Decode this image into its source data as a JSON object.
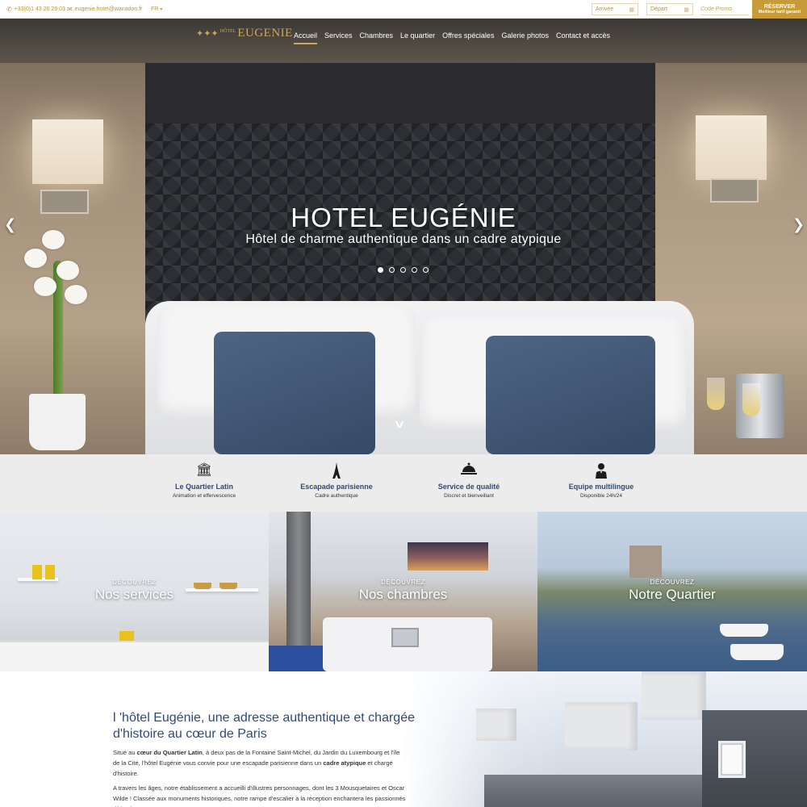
{
  "topbar": {
    "phone": "+33(0)1 43 26 29 03",
    "email": "eugenie.hotel@wanadoo.fr",
    "lang": "FR",
    "arrival_placeholder": "Arrivée",
    "departure_placeholder": "Départ",
    "promo_placeholder": "Code Promo",
    "reserve_label": "RÉSERVER",
    "reserve_sub": "Meilleur tarif garanti"
  },
  "nav": {
    "logo_small": "HÔTEL",
    "logo_name": "EUGENIE",
    "items": [
      {
        "label": "Accueil"
      },
      {
        "label": "Services"
      },
      {
        "label": "Chambres"
      },
      {
        "label": "Le quartier"
      },
      {
        "label": "Offres spéciales"
      },
      {
        "label": "Galerie photos"
      },
      {
        "label": "Contact et accès"
      }
    ],
    "active_index": 0
  },
  "hero": {
    "title": "HOTEL EUGÉNIE",
    "subtitle": "Hôtel de charme authentique dans un cadre atypique",
    "slide_count": 5,
    "active_slide": 1
  },
  "features": [
    {
      "icon": "monument-icon",
      "title": "Le Quartier Latin",
      "sub": "Animation et effervescence"
    },
    {
      "icon": "eiffel-tower-icon",
      "title": "Escapade parisienne",
      "sub": "Cadre authentique"
    },
    {
      "icon": "cloche-icon",
      "title": "Service de qualité",
      "sub": "Discret et bienveillant"
    },
    {
      "icon": "concierge-icon",
      "title": "Equipe multilingue",
      "sub": "Disponible 24h/24"
    }
  ],
  "tiles": [
    {
      "kicker": "DÉCOUVREZ",
      "title": "Nos services"
    },
    {
      "kicker": "DÉCOUVREZ",
      "title": "Nos chambres"
    },
    {
      "kicker": "DÉCOUVREZ",
      "title": "Notre Quartier"
    }
  ],
  "about": {
    "heading": "l 'hôtel Eugénie, une adresse authentique et chargée d'histoire au cœur de Paris",
    "p1_a": "Situé au ",
    "p1_b": "cœur du Quartier Latin",
    "p1_c": ", à deux pas de la Fontaine Saint-Michel, du Jardin du Luxembourg et l'île de la Cité, l'hôtel Eugénie vous convie pour une escapade parisienne dans un ",
    "p1_d": "cadre atypique",
    "p1_e": " et chargé d'histoire.",
    "p2": "A travers les âges, notre établissement a accueilli d'illustres personnages, dont les 3 Mousquetaires et Oscar Wilde ! Classée aux monuments historiques, notre rampe d'escalier à la réception enchantera les passionnés d'histoire."
  },
  "colors": {
    "gold": "#c79a3a",
    "navy_text": "#2f4a7a",
    "feature_band": "#ececec"
  }
}
